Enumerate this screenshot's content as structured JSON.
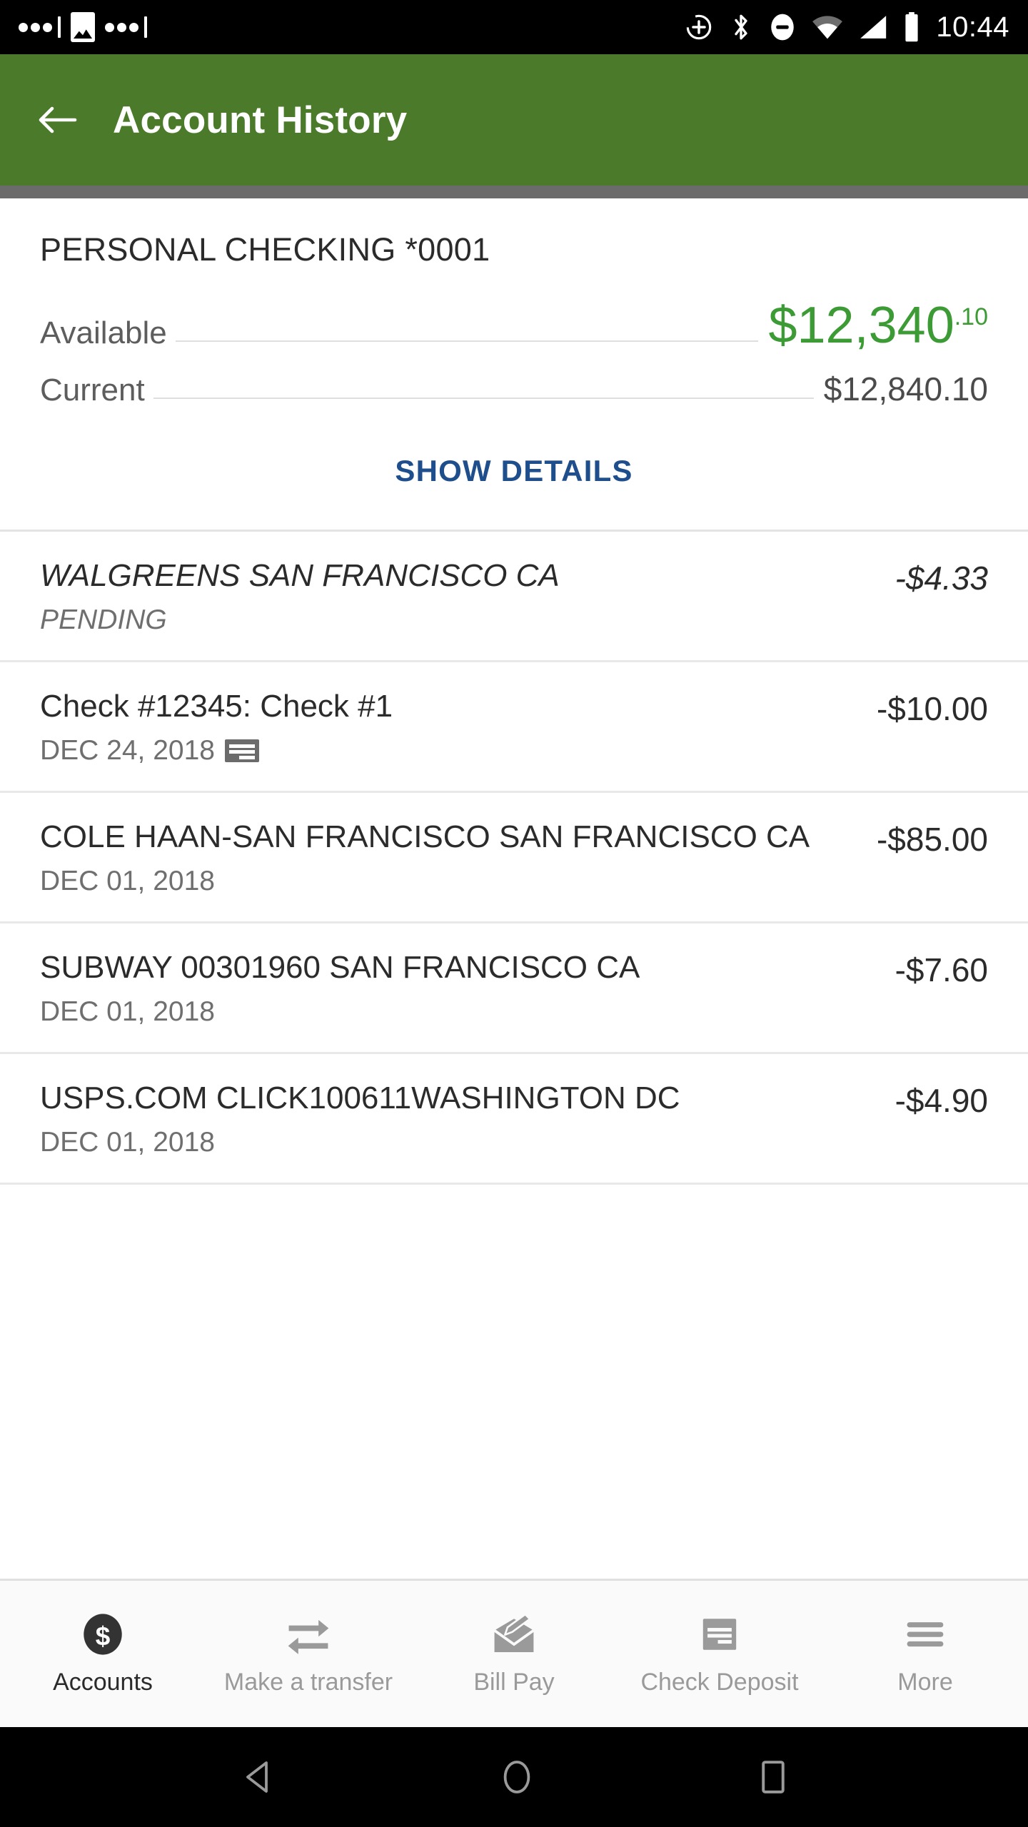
{
  "status_bar": {
    "time": "10:44",
    "left_icons": [
      "more-dots-icon",
      "image-notification-icon",
      "more-dots-icon"
    ],
    "right_icons": [
      "circle-plus-icon",
      "bluetooth-icon",
      "do-not-disturb-icon",
      "wifi-icon",
      "cellular-signal-icon",
      "battery-icon"
    ]
  },
  "app_bar": {
    "title": "Account History",
    "back_icon": "arrow-left-icon",
    "background_color": "#4a7a2a"
  },
  "account": {
    "name": "PERSONAL CHECKING *0001",
    "available_label": "Available",
    "available_amount": "$12,340",
    "available_cents": ".10",
    "available_color": "#3d9b35",
    "current_label": "Current",
    "current_amount": "$12,840.10",
    "show_details_label": "SHOW DETAILS",
    "show_details_color": "#1f4e8c"
  },
  "transactions": [
    {
      "description": "WALGREENS SAN FRANCISCO CA",
      "sub": "PENDING",
      "amount": "-$4.33",
      "pending": true,
      "has_check_icon": false
    },
    {
      "description": "Check #12345: Check #1",
      "sub": "DEC 24, 2018",
      "amount": "-$10.00",
      "pending": false,
      "has_check_icon": true
    },
    {
      "description": "COLE HAAN-SAN FRANCISCO SAN FRANCISCO CA",
      "sub": "DEC 01, 2018",
      "amount": "-$85.00",
      "pending": false,
      "has_check_icon": false
    },
    {
      "description": "SUBWAY 00301960 SAN FRANCISCO CA",
      "sub": "DEC 01, 2018",
      "amount": "-$7.60",
      "pending": false,
      "has_check_icon": false
    },
    {
      "description": "USPS.COM CLICK100611WASHINGTON DC",
      "sub": "DEC 01, 2018",
      "amount": "-$4.90",
      "pending": false,
      "has_check_icon": false
    }
  ],
  "tabs": [
    {
      "label": "Accounts",
      "icon": "dollar-circle-icon",
      "active": true
    },
    {
      "label": "Make a transfer",
      "icon": "transfer-arrows-icon",
      "active": false
    },
    {
      "label": "Bill Pay",
      "icon": "envelope-pen-icon",
      "active": false
    },
    {
      "label": "Check Deposit",
      "icon": "check-document-icon",
      "active": false
    },
    {
      "label": "More",
      "icon": "hamburger-menu-icon",
      "active": false
    }
  ],
  "android_nav": {
    "back_icon": "triangle-back-icon",
    "home_icon": "circle-home-icon",
    "recents_icon": "square-recents-icon"
  }
}
